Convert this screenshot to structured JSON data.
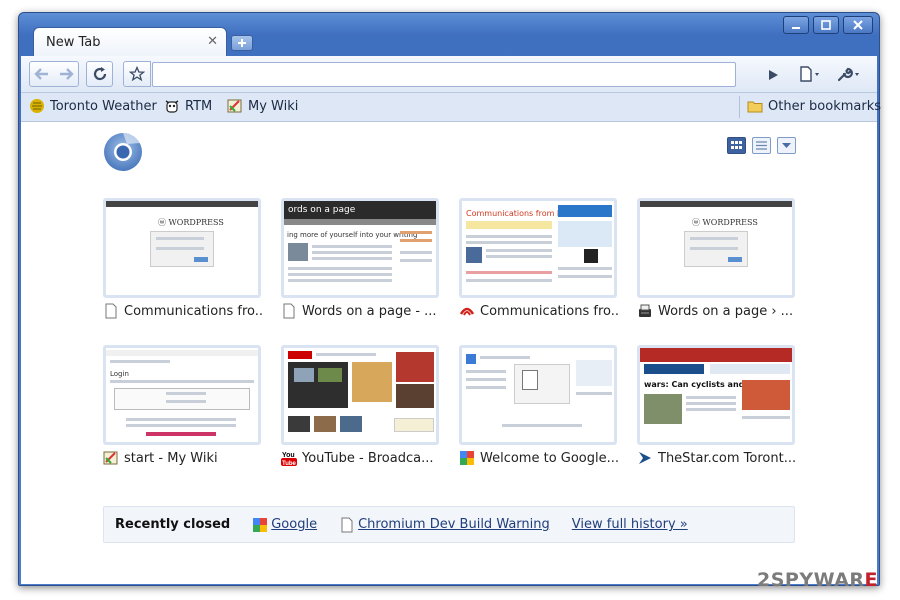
{
  "window": {
    "tab_title": "New Tab",
    "controls": [
      "minimize-icon",
      "maximize-icon",
      "close-icon"
    ]
  },
  "toolbar": {
    "back_icon": "back-arrow-icon",
    "forward_icon": "forward-arrow-icon",
    "reload_icon": "reload-icon",
    "star_icon": "star-icon",
    "address_value": "",
    "go_icon": "play-icon",
    "page_menu_icon": "page-icon",
    "tools_menu_icon": "wrench-icon"
  },
  "bookmarks": {
    "items": [
      {
        "label": "Toronto Weather",
        "icon": "weather-icon"
      },
      {
        "label": "RTM",
        "icon": "cow-icon"
      },
      {
        "label": "My Wiki",
        "icon": "wiki-icon"
      }
    ],
    "other": {
      "label": "Other bookmarks",
      "icon": "folder-icon"
    }
  },
  "most_visited": [
    {
      "caption": "Communications fro...",
      "favicon": "page-icon"
    },
    {
      "caption": "Words on a page - ...",
      "favicon": "page-icon"
    },
    {
      "caption": "Communications fro...",
      "favicon": "dmn-icon"
    },
    {
      "caption": "Words on a page › ...",
      "favicon": "typewriter-icon"
    },
    {
      "caption": "start - My Wiki",
      "favicon": "wiki-icon"
    },
    {
      "caption": "YouTube - Broadca...",
      "favicon": "youtube-icon"
    },
    {
      "caption": "Welcome to Google...",
      "favicon": "google-icon"
    },
    {
      "caption": "TheStar.com Toront...",
      "favicon": "star-arrow-icon"
    }
  ],
  "recently_closed": {
    "title": "Recently closed",
    "items": [
      {
        "label": "Google",
        "icon": "google-icon"
      },
      {
        "label": "Chromium Dev Build Warning",
        "icon": "page-icon"
      }
    ],
    "history_link": "View full history »"
  },
  "watermark": {
    "prefix": "2SPYWAR",
    "suffix": "E"
  },
  "colors": {
    "frame": "#4a7cc9",
    "link": "#1f3e7c",
    "thumb_border": "#dae3f1"
  }
}
